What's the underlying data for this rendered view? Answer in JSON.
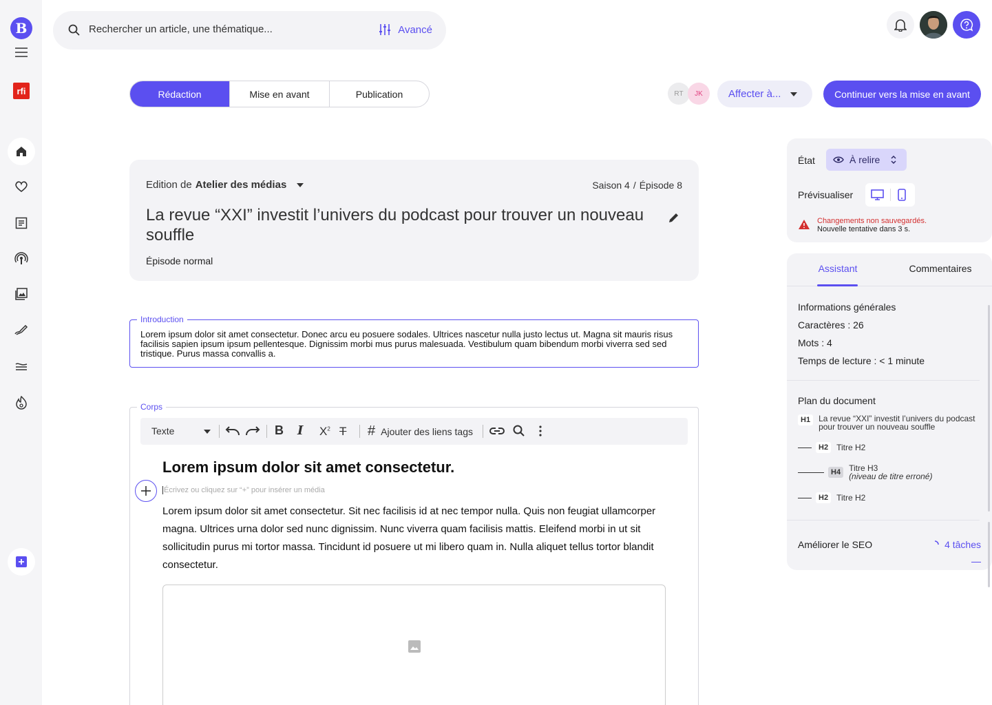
{
  "sidebar": {
    "logo": "B",
    "brand": "rfi"
  },
  "search": {
    "placeholder": "Rechercher un article, une thématique...",
    "advanced": "Avancé"
  },
  "tabs": [
    "Rédaction",
    "Mise en avant",
    "Publication"
  ],
  "assignees": [
    "RT",
    "JK"
  ],
  "assign_label": "Affecter à...",
  "cta_label": "Continuer vers la mise en avant",
  "article": {
    "edition_prefix": "Edition de",
    "edition_name": "Atelier des médias",
    "season": "Saison 4",
    "separator": "/",
    "episode": "Épisode 8",
    "title": "La revue “XXI” investit l’univers du podcast pour trouver un nouveau souffle",
    "type": "Épisode normal"
  },
  "intro": {
    "label": "Introduction",
    "text": "Lorem ipsum dolor sit amet consectetur. Donec arcu eu posuere sodales. Ultrices nascetur nulla justo lectus ut. Magna sit mauris risus facilisis sapien ipsum ipsum pellentesque. Dignissim morbi mus purus malesuada. Vestibulum quam bibendum morbi viverra sed sed tristique. Purus massa convallis a."
  },
  "body": {
    "label": "Corps",
    "toolbar": {
      "format": "Texte",
      "tags": "Ajouter des liens tags"
    },
    "heading": "Lorem ipsum dolor sit amet consectetur.",
    "placeholder": "Écrivez ou cliquez sur “+” pour insérer un média",
    "paragraph": "Lorem ipsum dolor sit amet consectetur. Sit nec facilisis id at nec tempor nulla. Quis non feugiat ullamcorper magna. Ultrices urna dolor sed nunc dignissim. Nunc viverra quam facilisis mattis. Eleifend morbi in ut sit sollicitudin purus mi tortor massa. Tincidunt id posuere ut mi libero quam in. Nulla aliquet tellus tortor blandit consectetur."
  },
  "status": {
    "state_label": "État",
    "state_value": "À relire",
    "preview_label": "Prévisualiser",
    "warning_title": "Changements non sauvegardés.",
    "warning_sub": "Nouvelle tentative dans 3 s."
  },
  "assistant": {
    "tabs": [
      "Assistant",
      "Commentaires"
    ],
    "info_title": "Informations générales",
    "chars": "Caractères : 26",
    "words": "Mots : 4",
    "reading": "Temps de lecture : < 1 minute",
    "plan_title": "Plan du document",
    "plan": [
      {
        "level": "H1",
        "text": "La revue “XXI” investit l’univers du podcast pour trouver un nouveau souffle",
        "note": ""
      },
      {
        "level": "H2",
        "text": "Titre H2",
        "note": ""
      },
      {
        "level": "H4",
        "text": "Titre H3",
        "note": "(niveau de titre erroné)"
      },
      {
        "level": "H2",
        "text": "Titre H2",
        "note": ""
      }
    ],
    "seo_label": "Améliorer le SEO",
    "seo_tasks": "4 tâches"
  },
  "colors": {
    "accent": "#5b4ff0",
    "warning": "#d32f2f"
  }
}
